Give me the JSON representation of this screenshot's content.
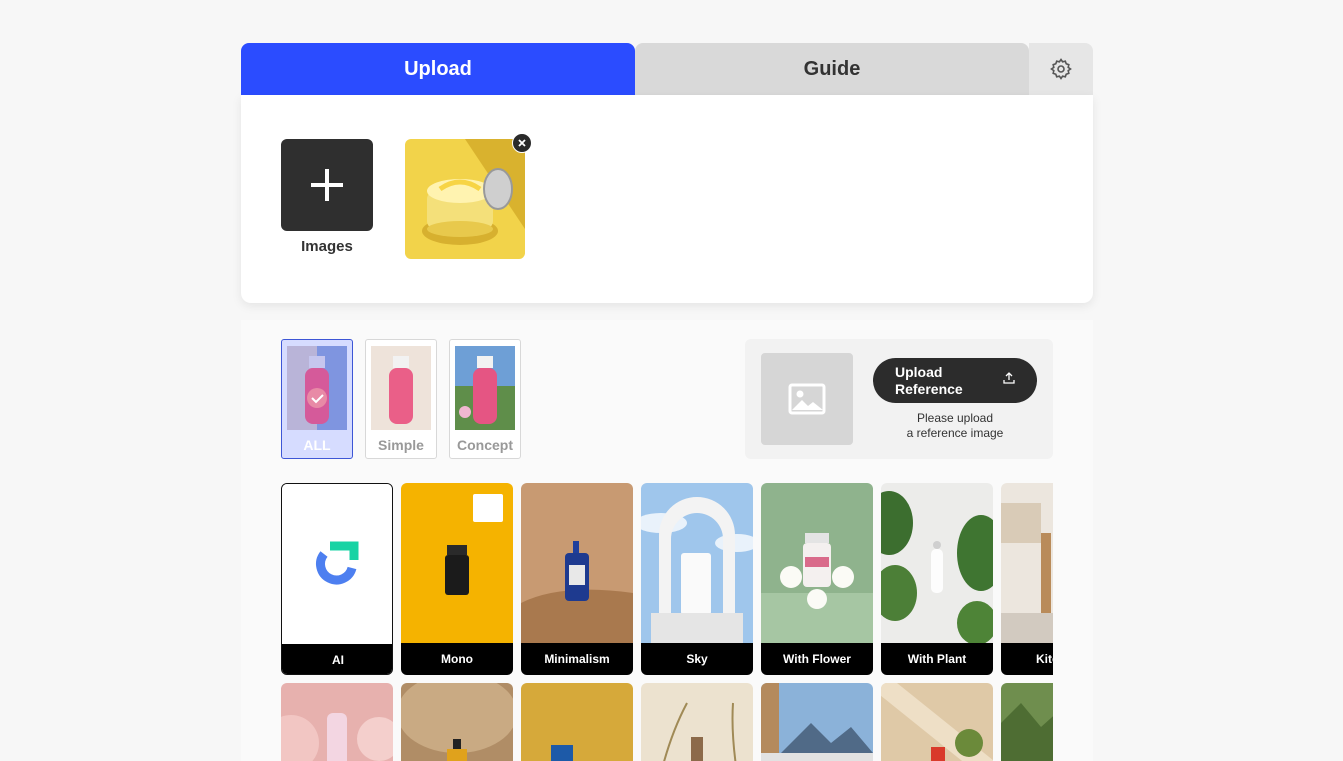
{
  "tabs": {
    "upload": "Upload",
    "guide": "Guide"
  },
  "upload": {
    "add_label": "Images"
  },
  "filters": [
    {
      "label": "ALL",
      "active": true
    },
    {
      "label": "Simple",
      "active": false
    },
    {
      "label": "Concept",
      "active": false
    }
  ],
  "reference": {
    "button_line1": "Upload",
    "button_line2": "Reference",
    "note_line1": "Please upload",
    "note_line2": "a reference image"
  },
  "styles": [
    "AI",
    "Mono",
    "Minimalism",
    "Sky",
    "With Flower",
    "With Plant",
    "Kitchen"
  ],
  "colors": {
    "accent": "#2b4cff",
    "tab_inactive": "#d9d9d9",
    "dark": "#2f2f2f"
  }
}
